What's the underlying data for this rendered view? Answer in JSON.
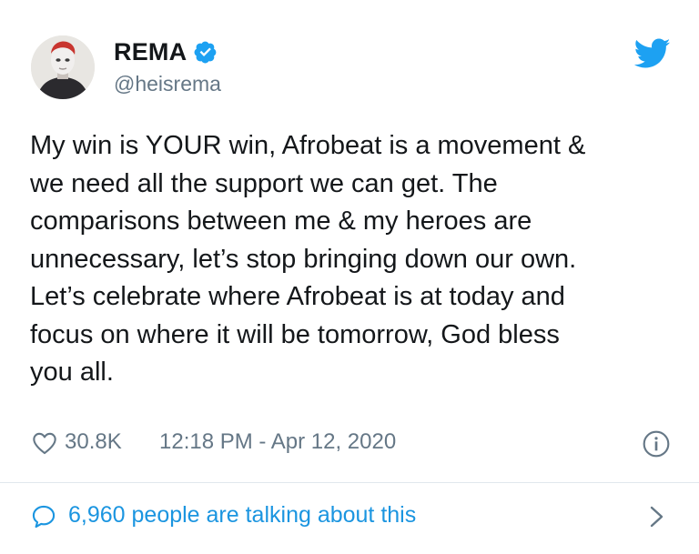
{
  "author": {
    "name": "REMA",
    "handle": "@heisrema",
    "verified": true
  },
  "tweet": {
    "lines": [
      "My win is YOUR win, Afrobeat is a movement &",
      "we need all the support we can get. The",
      "comparisons between me & my heroes are",
      "unnecessary, let’s stop bringing down our own.",
      "Let’s celebrate where Afrobeat is at today and",
      "focus on where it will be tomorrow, God bless",
      "you all."
    ]
  },
  "meta": {
    "likes": "30.8K",
    "timestamp": "12:18 PM - Apr 12, 2020"
  },
  "conversation": {
    "text": "6,960 people are talking about this"
  },
  "colors": {
    "twitter_blue": "#1da1f2",
    "link_blue": "#1b95e0",
    "muted_gray": "#657786",
    "text": "#14171a",
    "divider": "#e1e8ed"
  },
  "icons": {
    "brand": "twitter-bird-icon",
    "verified": "verified-badge-icon",
    "like": "heart-icon",
    "info": "info-icon",
    "reply": "speech-bubble-icon",
    "more": "chevron-right-icon"
  }
}
